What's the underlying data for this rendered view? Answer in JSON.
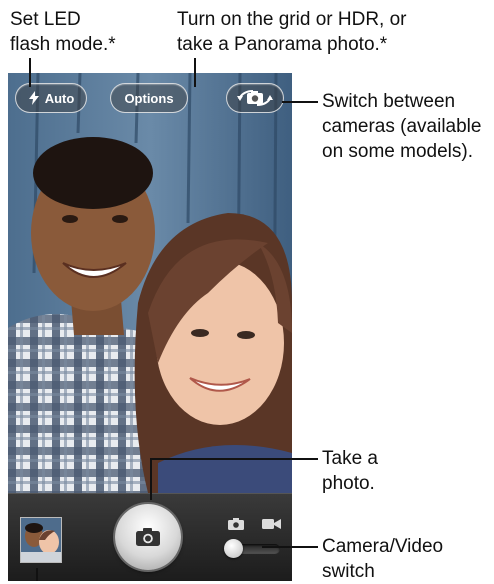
{
  "callouts": {
    "flash": {
      "line1": "Set LED",
      "line2": "flash mode.*"
    },
    "options": {
      "line1": "Turn on the grid or HDR, or",
      "line2": "take a Panorama photo.*"
    },
    "switch_cameras": {
      "line1": "Switch between",
      "line2": "cameras (available",
      "line3": "on some models)."
    },
    "take_photo": {
      "line1": "Take a",
      "line2": "photo."
    },
    "camera_video": {
      "line1": "Camera/Video",
      "line2": "switch"
    }
  },
  "camera_ui": {
    "flash_label": "Auto",
    "options_label": "Options",
    "icons": {
      "flash": "lightning-bolt-icon",
      "switch_camera": "camera-rotate-icon",
      "shutter": "camera-icon",
      "photo_mode": "camera-icon",
      "video_mode": "video-camera-icon"
    },
    "mode_switch_value": "camera"
  },
  "colors": {
    "toolbar": "#2a2a2a",
    "pill_border": "#ffffff",
    "callout_text": "#111111",
    "shutter": "#e5e5e5"
  }
}
